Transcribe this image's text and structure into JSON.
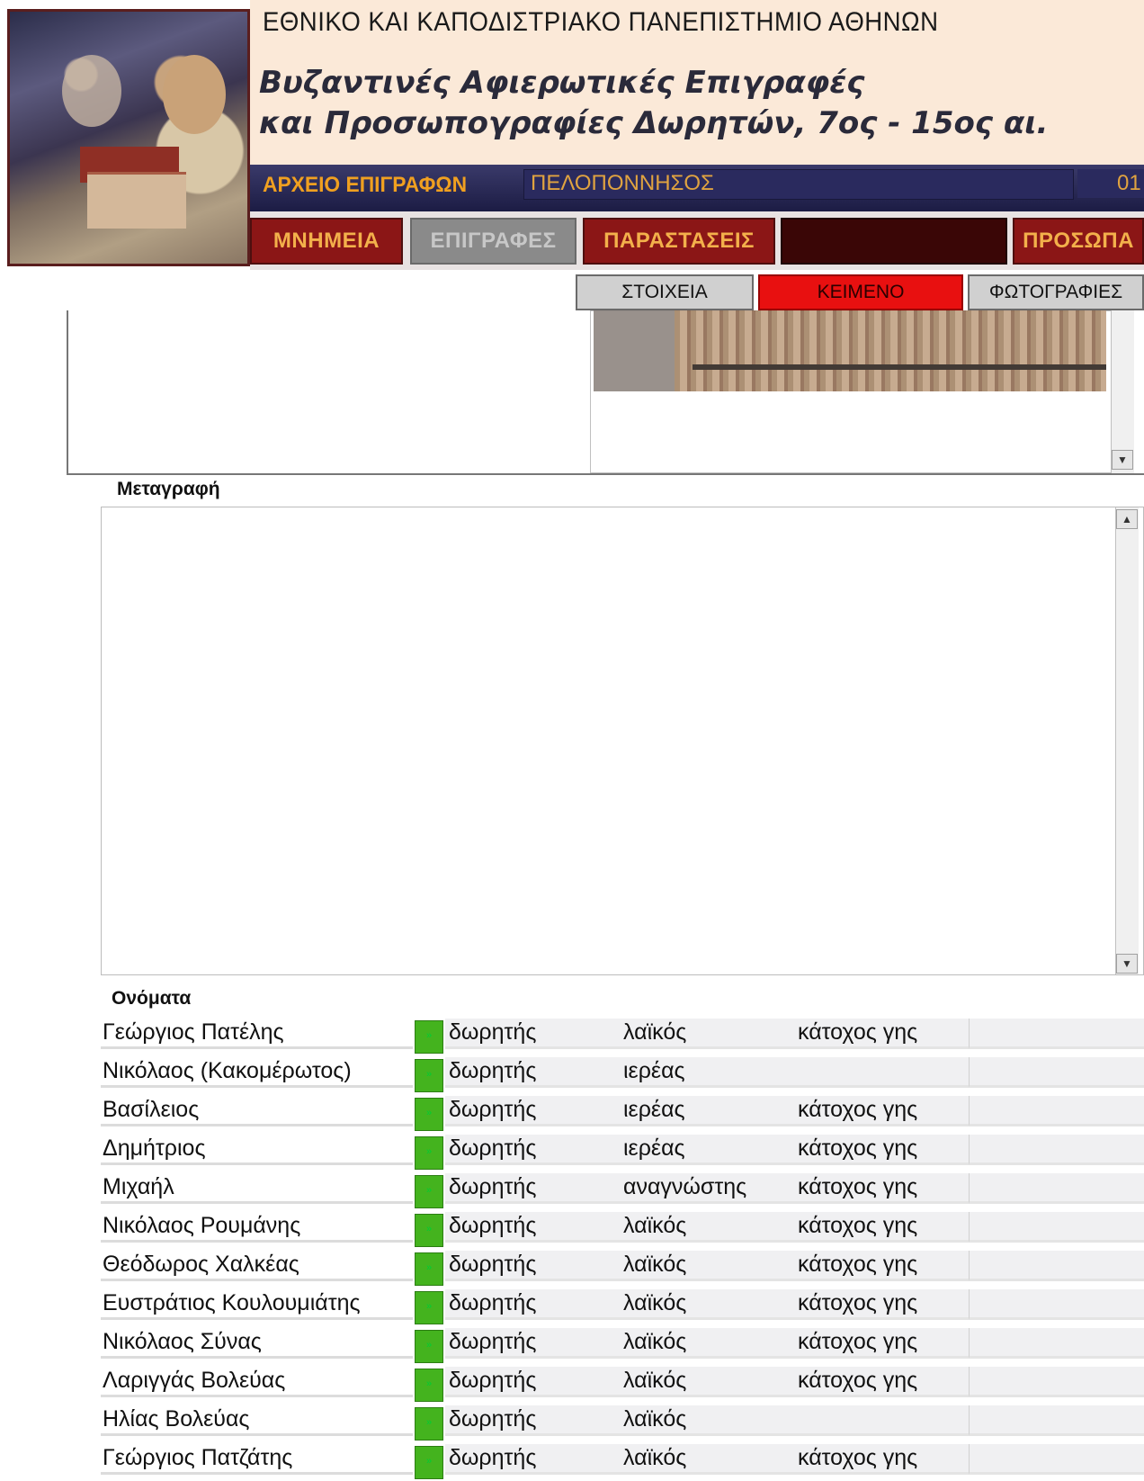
{
  "header": {
    "university": "ΕΘΝΙΚΟ ΚΑΙ ΚΑΠΟΔΙΣΤΡΙΑΚΟ ΠΑΝΕΠΙΣΤΗΜΙΟ ΑΘΗΝΩΝ",
    "project_line1": "Βυζαντινές Αφιερωτικές Επιγραφές",
    "project_line2": "και Προσωπογραφίες Δωρητών,  7ος - 15ος αι.",
    "archive_label": "ΑΡΧΕΙΟ ΕΠΙΓΡΑΦΩΝ",
    "region": "ΠΕΛΟΠΟΝΝΗΣΟΣ",
    "record_id": "01"
  },
  "nav": {
    "monuments": "ΜΝΗΜΕΙΑ",
    "inscriptions": "ΕΠΙΓΡΑΦΕΣ",
    "depictions": "ΠΑΡΑΣΤΑΣΕΙΣ",
    "persons": "ΠΡΟΣΩΠΑ"
  },
  "subtabs": {
    "details": "ΣΤΟΙΧΕΙΑ",
    "text": "ΚΕΙΜΕΝΟ",
    "photos": "ΦΩΤΟΓΡΑΦΙΕΣ"
  },
  "transcription": {
    "label": "Μεταγραφή",
    "value": ""
  },
  "names": {
    "label": "Ονόματα",
    "rows": [
      {
        "name": "Γεώργιος Πατέλης",
        "role": "δωρητής",
        "status": "λαϊκός",
        "property": "κάτοχος γης"
      },
      {
        "name": "Νικόλαος (Κακομέρωτος)",
        "role": "δωρητής",
        "status": "ιερέας",
        "property": ""
      },
      {
        "name": "Βασίλειος",
        "role": "δωρητής",
        "status": "ιερέας",
        "property": "κάτοχος γης"
      },
      {
        "name": "Δημήτριος",
        "role": "δωρητής",
        "status": "ιερέας",
        "property": "κάτοχος γης"
      },
      {
        "name": "Μιχαήλ",
        "role": "δωρητής",
        "status": "αναγνώστης",
        "property": "κάτοχος γης"
      },
      {
        "name": "Νικόλαος Ρουμάνης",
        "role": "δωρητής",
        "status": "λαϊκός",
        "property": "κάτοχος γης"
      },
      {
        "name": "Θεόδωρος Χαλκέας",
        "role": "δωρητής",
        "status": "λαϊκός",
        "property": "κάτοχος γης"
      },
      {
        "name": "Ευστράτιος Κουλουμιάτης",
        "role": "δωρητής",
        "status": "λαϊκός",
        "property": "κάτοχος γης"
      },
      {
        "name": "Νικόλαος Σύνας",
        "role": "δωρητής",
        "status": "λαϊκός",
        "property": "κάτοχος γης"
      },
      {
        "name": "Λαριγγάς Βολεύας",
        "role": "δωρητής",
        "status": "λαϊκός",
        "property": "κάτοχος γης"
      },
      {
        "name": "Ηλίας Βολεύας",
        "role": "δωρητής",
        "status": "λαϊκός",
        "property": ""
      },
      {
        "name": "Γεώργιος Πατζάτης",
        "role": "δωρητής",
        "status": "λαϊκός",
        "property": "κάτοχος γης"
      }
    ]
  },
  "colors": {
    "nav_button": "#8b1616",
    "nav_text": "#f3b04b",
    "active_tab": "#e81010",
    "go_button": "#44b31e",
    "header_bg": "#fbe9d8",
    "bar_bg": "#1c1c44"
  },
  "icons": {
    "scroll_up": "up-arrow-icon",
    "scroll_down": "down-arrow-icon",
    "row_go": "go-button-icon"
  }
}
